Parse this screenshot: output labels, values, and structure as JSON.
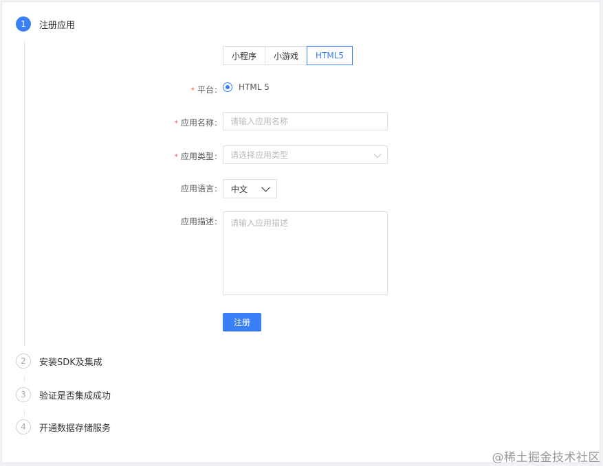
{
  "steps": [
    {
      "number": "1",
      "title": "注册应用",
      "state": "active"
    },
    {
      "number": "2",
      "title": "安装SDK及集成",
      "state": "inactive"
    },
    {
      "number": "3",
      "title": "验证是否集成成功",
      "state": "inactive"
    },
    {
      "number": "4",
      "title": "开通数据存储服务",
      "state": "inactive"
    }
  ],
  "app_type_tabs": [
    {
      "label": "小程序",
      "selected": false
    },
    {
      "label": "小游戏",
      "selected": false
    },
    {
      "label": "HTML5",
      "selected": true
    }
  ],
  "form": {
    "platform": {
      "label": "平台",
      "required": true,
      "option": "HTML 5"
    },
    "app_name": {
      "label": "应用名称",
      "required": true,
      "placeholder": "请输入应用名称"
    },
    "app_category": {
      "label": "应用类型",
      "required": true,
      "placeholder": "请选择应用类型"
    },
    "app_language": {
      "label": "应用语言",
      "required": false,
      "value": "中文"
    },
    "app_description": {
      "label": "应用描述",
      "required": false,
      "placeholder": "请输入应用描述"
    },
    "submit_label": "注册"
  },
  "watermark": "@稀土掘金技术社区",
  "colors": {
    "accent": "#3b7ff6",
    "required_mark": "#e65a5a",
    "border": "#dcdfe6"
  }
}
